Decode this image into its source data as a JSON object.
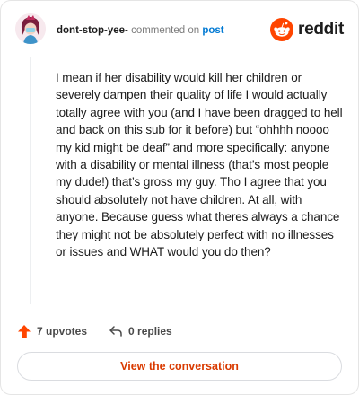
{
  "header": {
    "username": "dont-stop-yee-",
    "verb": "commented on",
    "post_link": "post",
    "brand": "reddit"
  },
  "comment": {
    "body": "I mean if her disability would kill her children or severely dampen their quality of life I would actually totally agree with you (and I have been dragged to hell and back on this sub for it before) but “ohhhh noooo my kid might be deaf” and more specifically: anyone with a disability or mental illness (that’s most people my dude!) that’s gross my guy. Tho I agree that you should absolutely not have children. At all, with anyone. Because guess what theres always a chance they might not be absolutely perfect with no illnesses or issues and WHAT would you do then?"
  },
  "actions": {
    "upvotes": "7 upvotes",
    "replies": "0 replies"
  },
  "cta": {
    "label": "View the conversation"
  },
  "icons": {
    "upvote": "upvote-arrow-icon",
    "reply": "reply-arrow-icon",
    "logo": "reddit-snoo-icon",
    "avatar": "user-avatar-icon"
  },
  "colors": {
    "brand_orange": "#ff4500",
    "link_blue": "#0079d3",
    "cta_text": "#d93a00"
  }
}
